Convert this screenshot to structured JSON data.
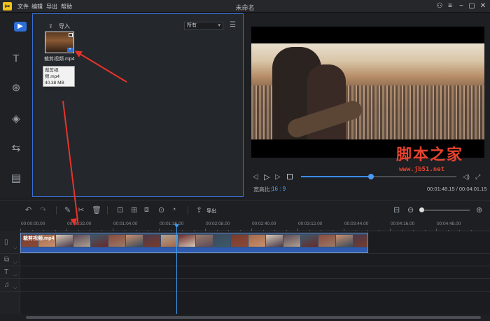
{
  "app": {
    "logo_char": "✂",
    "title": "未命名",
    "menu": [
      "文件",
      "编辑",
      "导出",
      "帮助"
    ]
  },
  "window_controls": [
    "user-icon",
    "menu-icon",
    "minimize-icon",
    "maximize-icon",
    "close-icon"
  ],
  "rail": {
    "items": [
      "media-icon",
      "text-icon",
      "filter-icon",
      "overlay-icon",
      "transition-icon",
      "film-icon"
    ],
    "active": "media-icon"
  },
  "media": {
    "import_label": "导入",
    "filter_value": "所有",
    "item": {
      "name": "裁剪视频.mp4",
      "tooltip_name": "裁剪视频.mp4",
      "size": "40.38 MB",
      "duration": "00:04:01"
    }
  },
  "preview": {
    "aspect_label": "宽高比：",
    "aspect_value": "16 : 9",
    "time_current": "00:01:48.15",
    "time_total": "00:04:01.15",
    "time_sep": " / ",
    "progress": 0.45
  },
  "toolbar": {
    "export_label": "导出",
    "zoom": 0.02
  },
  "ruler": {
    "labels": [
      "00:00:00.00",
      "00:00:32.00",
      "00:01:04.00",
      "00:01:36.00",
      "00:02:08.00",
      "00:02:40.00",
      "00:03:12.00",
      "00:03:44.00",
      "00:04:16.00",
      "00:04:48.00"
    ]
  },
  "timeline": {
    "clip_name": "裁剪视频.mp4",
    "tracks": [
      "video-track",
      "text-track",
      "music-track"
    ]
  },
  "watermark": {
    "text": "脚本之家",
    "url": "www.jb51.net"
  },
  "colors": {
    "accent": "#3b8cf0",
    "annotation": "#e8332a"
  }
}
